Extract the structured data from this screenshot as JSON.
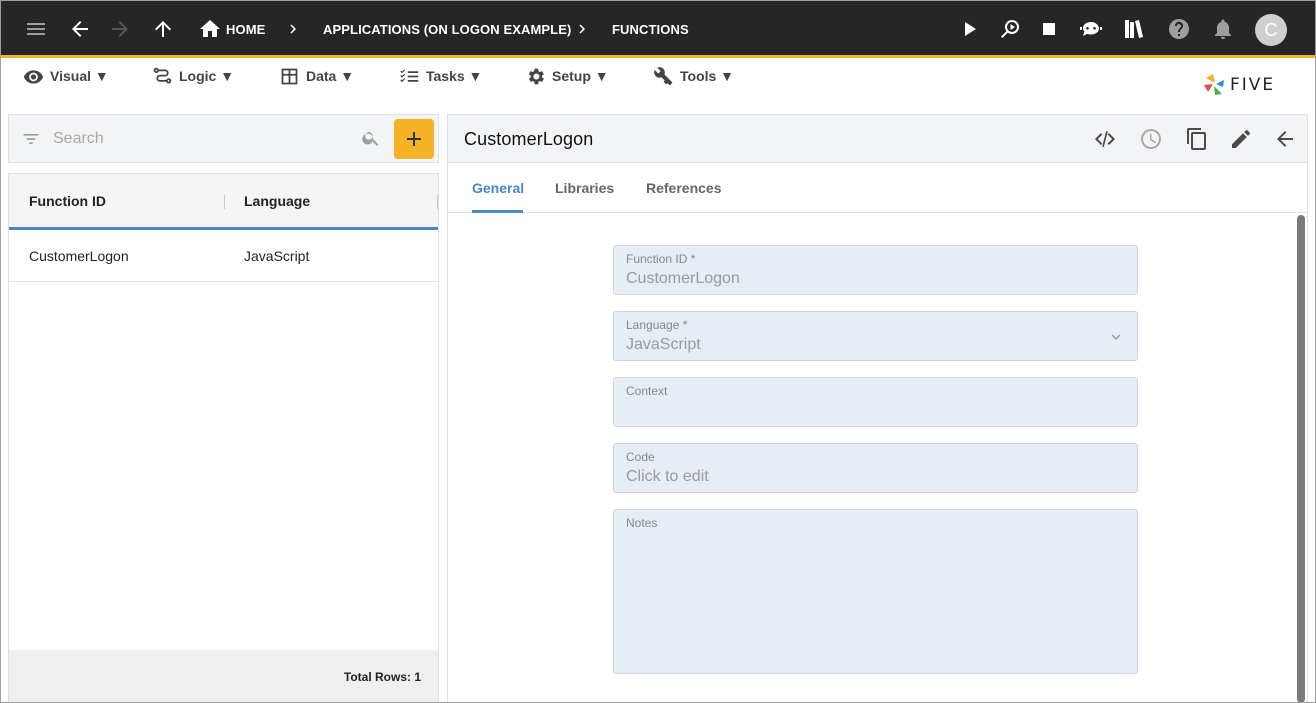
{
  "topbar": {
    "breadcrumbs": [
      {
        "label": "HOME"
      },
      {
        "label": "APPLICATIONS (ON LOGON EXAMPLE)"
      },
      {
        "label": "FUNCTIONS"
      }
    ],
    "avatar_initial": "C",
    "icons": [
      "menu-icon",
      "back-arrow-icon",
      "forward-arrow-icon",
      "up-arrow-icon",
      "home-icon",
      "play-icon",
      "debug-run-icon",
      "stop-icon",
      "chat-bot-icon",
      "library-books-icon",
      "help-icon",
      "bell-icon"
    ]
  },
  "menubar": {
    "items": [
      {
        "label": "Visual ▼",
        "icon": "eye-icon"
      },
      {
        "label": "Logic ▼",
        "icon": "flow-icon"
      },
      {
        "label": "Data ▼",
        "icon": "table-icon"
      },
      {
        "label": "Tasks ▼",
        "icon": "checklist-icon"
      },
      {
        "label": "Setup ▼",
        "icon": "gear-icon"
      },
      {
        "label": "Tools ▼",
        "icon": "tools-icon"
      }
    ],
    "logo_text": "FIVE"
  },
  "list": {
    "search_placeholder": "Search",
    "columns": [
      "Function ID",
      "Language"
    ],
    "rows": [
      {
        "function_id": "CustomerLogon",
        "language": "JavaScript"
      }
    ],
    "footer": "Total Rows: 1"
  },
  "detail": {
    "title": "CustomerLogon",
    "tabs": [
      "General",
      "Libraries",
      "References"
    ],
    "active_tab": "General",
    "fields": {
      "function_id": {
        "label": "Function ID *",
        "value": "CustomerLogon"
      },
      "language": {
        "label": "Language *",
        "value": "JavaScript"
      },
      "context": {
        "label": "Context",
        "value": ""
      },
      "code": {
        "label": "Code",
        "value": "Click to edit"
      },
      "notes": {
        "label": "Notes",
        "value": ""
      }
    }
  },
  "colors": {
    "topbar_bg": "#262626",
    "accent": "#f5b325",
    "tab_active": "#4a86c8",
    "field_bg": "#e6edf5"
  }
}
